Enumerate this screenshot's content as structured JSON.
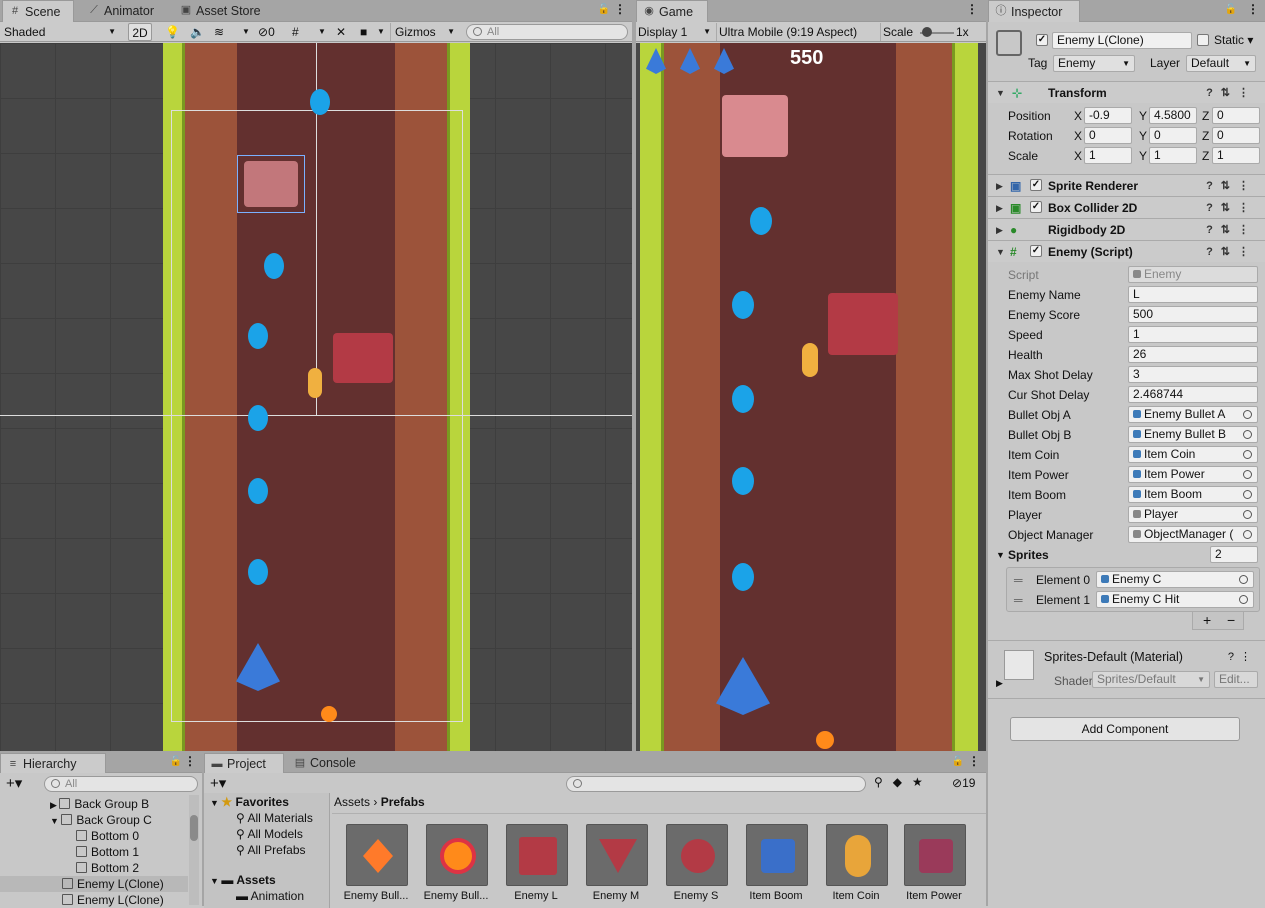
{
  "scene": {
    "tabs": [
      {
        "label": "Scene",
        "icon": "grid-icon"
      },
      {
        "label": "Animator",
        "icon": "animator-icon"
      },
      {
        "label": "Asset Store",
        "icon": "store-icon"
      }
    ],
    "shading": "Shaded",
    "mode2d": "2D",
    "hidden_count": "0",
    "gizmos": "Gizmos",
    "search_placeholder": "All"
  },
  "game": {
    "tab": "Game",
    "display": "Display 1",
    "aspect": "Ultra Mobile (9:19 Aspect)",
    "scale_label": "Scale",
    "scale_value": "1x",
    "score": "550"
  },
  "inspector": {
    "tab": "Inspector",
    "object_name": "Enemy L(Clone)",
    "static_label": "Static",
    "tag_label": "Tag",
    "tag": "Enemy",
    "layer_label": "Layer",
    "layer": "Default",
    "transform": {
      "title": "Transform",
      "rows": [
        {
          "label": "Position",
          "x": "-0.9",
          "y": "4.5800",
          "z": "0"
        },
        {
          "label": "Rotation",
          "x": "0",
          "y": "0",
          "z": "0"
        },
        {
          "label": "Scale",
          "x": "1",
          "y": "1",
          "z": "1"
        }
      ]
    },
    "components": [
      {
        "name": "Sprite Renderer"
      },
      {
        "name": "Box Collider 2D"
      },
      {
        "name": "Rigidbody 2D"
      },
      {
        "name": "Enemy (Script)"
      }
    ],
    "script_fields": [
      {
        "label": "Script",
        "value": "Enemy",
        "kind": "ref"
      },
      {
        "label": "Enemy Name",
        "value": "L"
      },
      {
        "label": "Enemy Score",
        "value": "500"
      },
      {
        "label": "Speed",
        "value": "1"
      },
      {
        "label": "Health",
        "value": "26"
      },
      {
        "label": "Max Shot Delay",
        "value": "3"
      },
      {
        "label": "Cur Shot Delay",
        "value": "2.468744"
      },
      {
        "label": "Bullet Obj A",
        "value": "Enemy Bullet A",
        "kind": "ref"
      },
      {
        "label": "Bullet Obj B",
        "value": "Enemy Bullet B",
        "kind": "ref"
      },
      {
        "label": "Item Coin",
        "value": "Item Coin",
        "kind": "ref"
      },
      {
        "label": "Item Power",
        "value": "Item Power",
        "kind": "ref"
      },
      {
        "label": "Item Boom",
        "value": "Item Boom",
        "kind": "ref"
      },
      {
        "label": "Player",
        "value": "Player",
        "kind": "ref"
      },
      {
        "label": "Object Manager",
        "value": "ObjectManager (",
        "kind": "ref"
      }
    ],
    "sprites": {
      "label": "Sprites",
      "count": "2",
      "elements": [
        {
          "label": "Element 0",
          "value": "Enemy C"
        },
        {
          "label": "Element 1",
          "value": "Enemy C Hit"
        }
      ]
    },
    "material": {
      "name": "Sprites-Default (Material)",
      "shader_label": "Shader",
      "shader": "Sprites/Default",
      "edit": "Edit..."
    },
    "add_component": "Add Component"
  },
  "hierarchy": {
    "tab": "Hierarchy",
    "search_placeholder": "All",
    "items": [
      "Back Group B",
      "Back Group C",
      "Bottom 0",
      "Bottom 1",
      "Bottom 2",
      "Enemy L(Clone)",
      "Enemy L(Clone)"
    ]
  },
  "project": {
    "tabs": [
      "Project",
      "Console"
    ],
    "hidden_count": "19",
    "favorites": "Favorites",
    "fav_items": [
      "All Materials",
      "All Models",
      "All Prefabs"
    ],
    "assets": "Assets",
    "asset_items": [
      "Animation"
    ],
    "breadcrumb": [
      "Assets",
      "Prefabs"
    ],
    "prefabs": [
      {
        "label": "Enemy Bull...",
        "icon": "bullet-orange-icon"
      },
      {
        "label": "Enemy Bull...",
        "icon": "bullet-round-icon"
      },
      {
        "label": "Enemy L",
        "icon": "enemy-l-icon"
      },
      {
        "label": "Enemy M",
        "icon": "enemy-m-icon"
      },
      {
        "label": "Enemy S",
        "icon": "enemy-s-icon"
      },
      {
        "label": "Item Boom",
        "icon": "item-boom-icon"
      },
      {
        "label": "Item Coin",
        "icon": "item-coin-icon"
      },
      {
        "label": "Item Power",
        "icon": "item-power-icon"
      }
    ]
  }
}
